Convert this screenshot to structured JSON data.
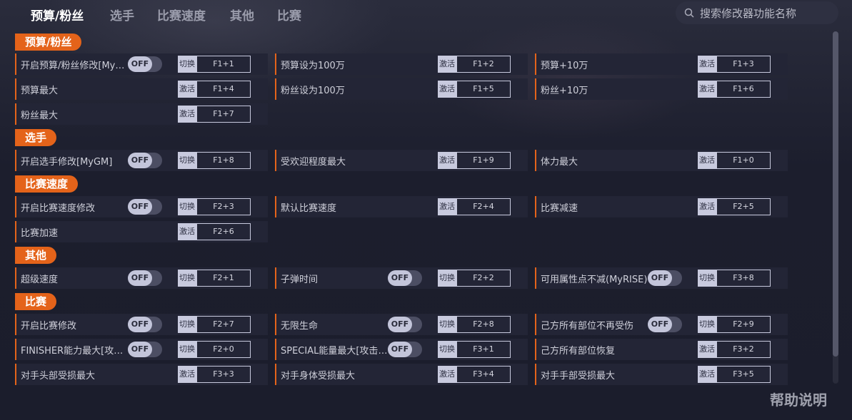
{
  "nav": {
    "tabs": [
      {
        "label": "预算/粉丝",
        "active": true
      },
      {
        "label": "选手"
      },
      {
        "label": "比赛速度"
      },
      {
        "label": "其他"
      },
      {
        "label": "比赛"
      }
    ]
  },
  "search": {
    "placeholder": "搜索修改器功能名称"
  },
  "help": {
    "label": "帮助说明"
  },
  "sections": [
    {
      "title": "预算/粉丝",
      "items": [
        {
          "label": "开启预算/粉丝修改[MyFaction]",
          "toggle": "OFF",
          "btn": "切换",
          "key": "F1+1"
        },
        {
          "label": "预算设为100万",
          "btn": "激活",
          "key": "F1+2"
        },
        {
          "label": "预算+10万",
          "btn": "激活",
          "key": "F1+3"
        },
        {
          "label": "预算最大",
          "btn": "激活",
          "key": "F1+4"
        },
        {
          "label": "粉丝设为100万",
          "btn": "激活",
          "key": "F1+5"
        },
        {
          "label": "粉丝+10万",
          "btn": "激活",
          "key": "F1+6"
        },
        {
          "label": "粉丝最大",
          "btn": "激活",
          "key": "F1+7"
        }
      ]
    },
    {
      "title": "选手",
      "items": [
        {
          "label": "开启选手修改[MyGM]",
          "toggle": "OFF",
          "btn": "切换",
          "key": "F1+8"
        },
        {
          "label": "受欢迎程度最大",
          "btn": "激活",
          "key": "F1+9"
        },
        {
          "label": "体力最大",
          "btn": "激活",
          "key": "F1+0"
        }
      ]
    },
    {
      "title": "比赛速度",
      "items": [
        {
          "label": "开启比赛速度修改",
          "toggle": "OFF",
          "btn": "切换",
          "key": "F2+3"
        },
        {
          "label": "默认比赛速度",
          "btn": "激活",
          "key": "F2+4"
        },
        {
          "label": "比赛减速",
          "btn": "激活",
          "key": "F2+5"
        },
        {
          "label": "比赛加速",
          "btn": "激活",
          "key": "F2+6"
        }
      ]
    },
    {
      "title": "其他",
      "items": [
        {
          "label": "超级速度",
          "toggle": "OFF",
          "btn": "切换",
          "key": "F2+1"
        },
        {
          "label": "子弹时间",
          "toggle": "OFF",
          "btn": "切换",
          "key": "F2+2"
        },
        {
          "label": "可用属性点不减(MyRISE)",
          "toggle": "OFF",
          "btn": "切换",
          "key": "F3+8"
        }
      ]
    },
    {
      "title": "比赛",
      "items": [
        {
          "label": "开启比赛修改",
          "toggle": "OFF",
          "btn": "切换",
          "key": "F2+7"
        },
        {
          "label": "无限生命",
          "toggle": "OFF",
          "btn": "切换",
          "key": "F2+8"
        },
        {
          "label": "己方所有部位不再受伤",
          "toggle": "OFF",
          "btn": "切换",
          "key": "F2+9"
        },
        {
          "label": "FINISHER能力最大[攻击时]",
          "toggle": "OFF",
          "btn": "切换",
          "key": "F2+0"
        },
        {
          "label": "SPECIAL能量最大[攻击时]",
          "toggle": "OFF",
          "btn": "切换",
          "key": "F3+1"
        },
        {
          "label": "己方所有部位恢复",
          "btn": "激活",
          "key": "F3+2"
        },
        {
          "label": "对手头部受损最大",
          "btn": "激活",
          "key": "F3+3"
        },
        {
          "label": "对手身体受损最大",
          "btn": "激活",
          "key": "F3+4"
        },
        {
          "label": "对手手部受损最大",
          "btn": "激活",
          "key": "F3+5"
        }
      ]
    }
  ]
}
